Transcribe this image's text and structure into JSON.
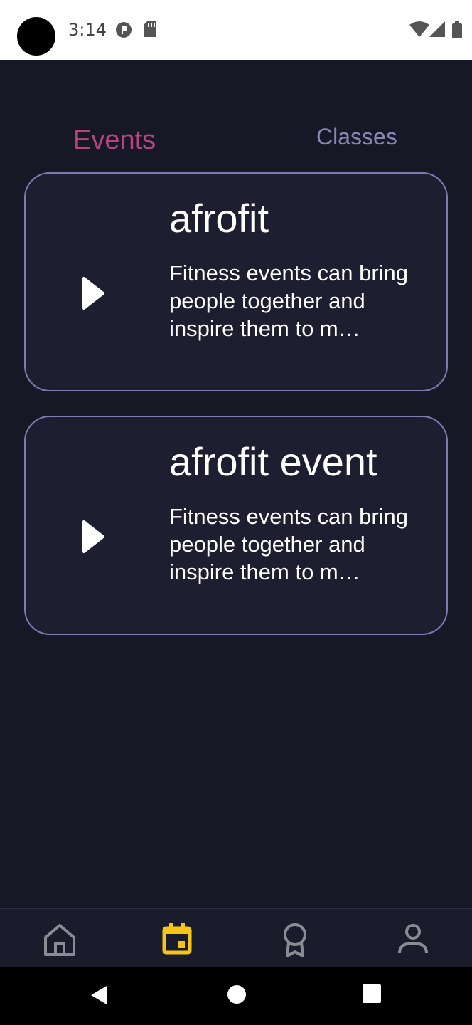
{
  "status_bar": {
    "time": "3:14",
    "icons": [
      "record-icon",
      "sd-card-icon",
      "wifi-icon",
      "cellular-icon",
      "battery-icon"
    ]
  },
  "tabs": [
    {
      "label": "Events",
      "active": true,
      "color": "#b6457f"
    },
    {
      "label": "Classes",
      "active": false,
      "color": "#8a86b3"
    }
  ],
  "events": [
    {
      "title": "afrofit",
      "description": "Fitness events can bring people together and inspire them to m…",
      "icon": "play-icon"
    },
    {
      "title": "afrofit event",
      "description": "Fitness events can bring people together and inspire them to m…",
      "icon": "play-icon"
    }
  ],
  "bottom_nav": {
    "items": [
      {
        "icon": "home-icon",
        "active": false
      },
      {
        "icon": "calendar-icon",
        "active": true
      },
      {
        "icon": "award-icon",
        "active": false
      },
      {
        "icon": "profile-icon",
        "active": false
      }
    ],
    "active_color": "#f5c518",
    "inactive_color": "#8b8b95"
  },
  "system_nav": [
    "back-icon",
    "home-circle-icon",
    "recents-icon"
  ]
}
